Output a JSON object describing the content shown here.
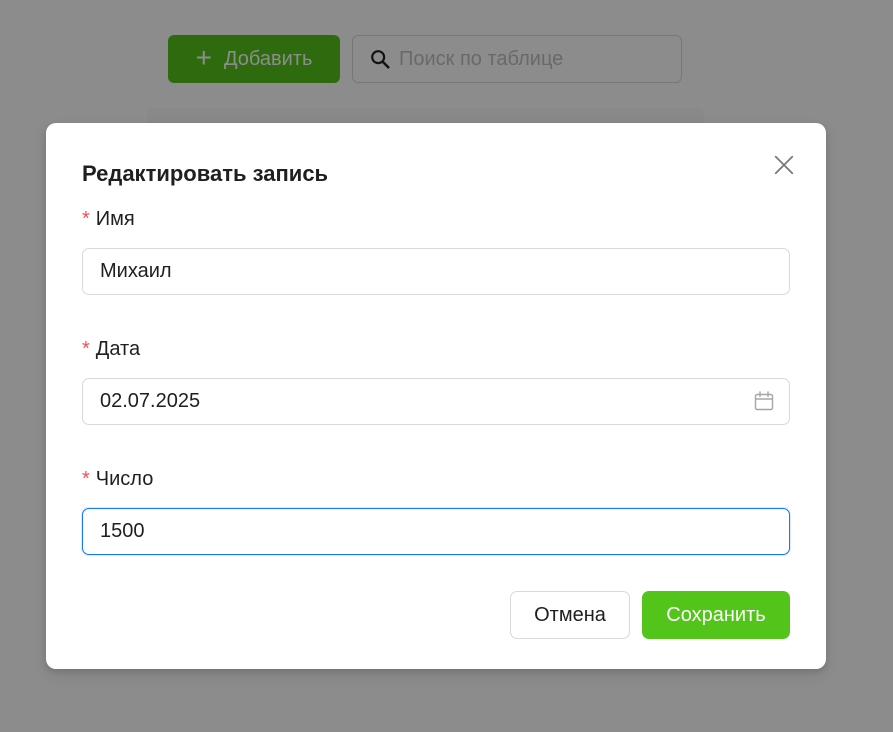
{
  "toolbar": {
    "add_label": "Добавить",
    "search_placeholder": "Поиск по таблице"
  },
  "modal": {
    "title": "Редактировать запись",
    "required_mark": "*",
    "fields": [
      {
        "label": "Имя",
        "value": "Михаил"
      },
      {
        "label": "Дата",
        "value": "02.07.2025"
      },
      {
        "label": "Число",
        "value": "1500"
      }
    ],
    "cancel_label": "Отмена",
    "save_label": "Сохранить"
  },
  "colors": {
    "accent": "#52c41a",
    "required": "#ff4d4f",
    "focus": "#1677ff",
    "overlay": "rgba(0,0,0,0.45)"
  },
  "icons": {
    "add": "plus-icon",
    "search": "search-icon",
    "close": "close-icon",
    "date": "calendar-icon"
  }
}
